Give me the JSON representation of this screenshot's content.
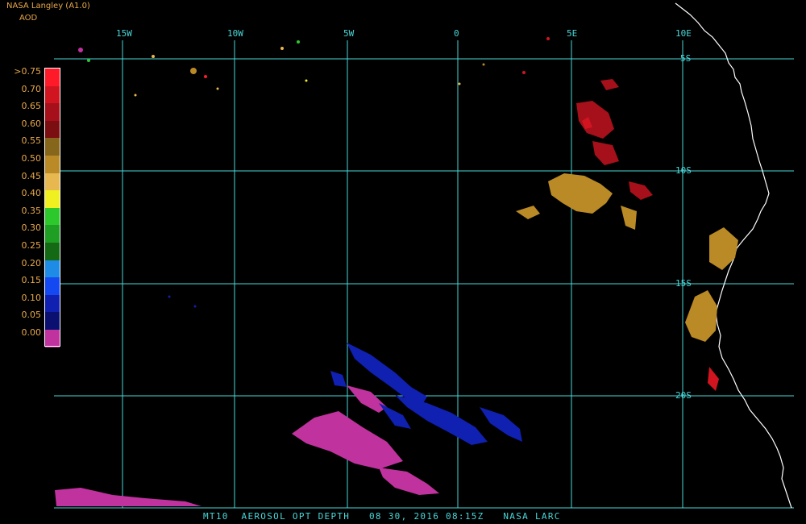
{
  "header": {
    "title": "NASA Langley (A1.0)",
    "product_label": "AOD"
  },
  "legend": {
    "labels": [
      ">0.75",
      "0.70",
      "0.65",
      "0.60",
      "0.55",
      "0.50",
      "0.45",
      "0.40",
      "0.35",
      "0.30",
      "0.25",
      "0.20",
      "0.15",
      "0.10",
      "0.05",
      "0.00"
    ],
    "colors": [
      "#ff1a2a",
      "#d11520",
      "#a5101a",
      "#7a0e10",
      "#86661b",
      "#b98a26",
      "#e8b850",
      "#f0f020",
      "#2cc82c",
      "#1e9e22",
      "#146a14",
      "#1e8ce6",
      "#1448f0",
      "#1020b0",
      "#0a1070",
      "#c0329e"
    ]
  },
  "grid": {
    "longitude_labels": [
      "15W",
      "10W",
      "5W",
      "0",
      "5E",
      "10E"
    ],
    "latitude_labels": [
      "5S",
      "10S",
      "15S",
      "20S"
    ],
    "line_color": "#49d7d9"
  },
  "footer": {
    "text": "MT10  AEROSOL OPT DEPTH   08 30, 2016 08:15Z   NASA LARC"
  },
  "colors": {
    "coastline": "#ffffff",
    "background": "#000000"
  }
}
